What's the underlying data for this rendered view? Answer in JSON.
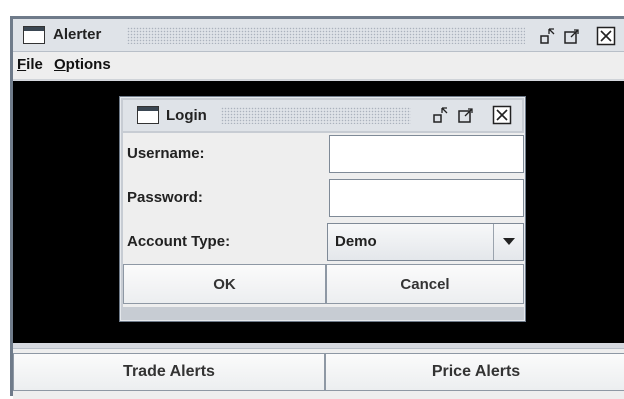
{
  "window": {
    "title": "Alerter",
    "buttons": [
      "minimize-icon",
      "maximize-icon",
      "close-icon"
    ]
  },
  "menu": {
    "items": [
      {
        "label": "File",
        "mnemonic": "F",
        "rest": "ile"
      },
      {
        "label": "Options",
        "mnemonic": "O",
        "rest": "ptions"
      }
    ]
  },
  "tabs": {
    "trade_alerts": "Trade Alerts",
    "price_alerts": "Price Alerts"
  },
  "login": {
    "title": "Login",
    "username_label": "Username:",
    "username_value": "",
    "password_label": "Password:",
    "password_value": "",
    "account_type_label": "Account Type:",
    "account_type_value": "Demo",
    "ok_label": "OK",
    "cancel_label": "Cancel"
  },
  "colors": {
    "content_background": "#000000",
    "window_chrome": "#dfe3e8"
  }
}
